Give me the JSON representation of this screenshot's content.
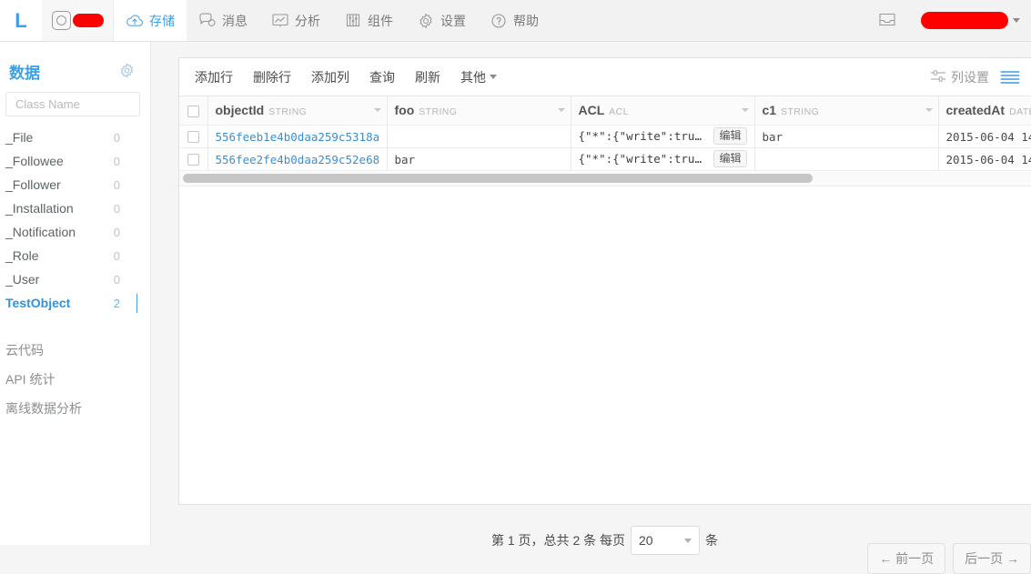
{
  "topnav": {
    "logo": "L",
    "app_name_redacted": "",
    "items": [
      {
        "label": "存储",
        "icon": "cloud-upload-icon",
        "active": true
      },
      {
        "label": "消息",
        "icon": "chat-icon",
        "active": false
      },
      {
        "label": "分析",
        "icon": "chart-icon",
        "active": false
      },
      {
        "label": "组件",
        "icon": "sliders-icon",
        "active": false
      },
      {
        "label": "设置",
        "icon": "gear-icon",
        "active": false
      },
      {
        "label": "帮助",
        "icon": "question-icon",
        "active": false
      }
    ],
    "inbox_icon": "inbox-icon",
    "user_name_redacted": ""
  },
  "sidebar": {
    "title": "数据",
    "settings_icon": "gear-icon",
    "search_placeholder": "Class Name",
    "search_value": "",
    "classes": [
      {
        "name": "_File",
        "count": "0",
        "selected": false
      },
      {
        "name": "_Followee",
        "count": "0",
        "selected": false
      },
      {
        "name": "_Follower",
        "count": "0",
        "selected": false
      },
      {
        "name": "_Installation",
        "count": "0",
        "selected": false
      },
      {
        "name": "_Notification",
        "count": "0",
        "selected": false
      },
      {
        "name": "_Role",
        "count": "0",
        "selected": false
      },
      {
        "name": "_User",
        "count": "0",
        "selected": false
      },
      {
        "name": "TestObject",
        "count": "2",
        "selected": true
      }
    ],
    "links": [
      {
        "label": "云代码"
      },
      {
        "label": "API 统计"
      },
      {
        "label": "离线数据分析"
      }
    ]
  },
  "toolbar": {
    "buttons": [
      {
        "label": "添加行"
      },
      {
        "label": "删除行"
      },
      {
        "label": "添加列"
      },
      {
        "label": "查询"
      },
      {
        "label": "刷新"
      },
      {
        "label": "其他",
        "caret": true
      }
    ],
    "column_settings_label": "列设置",
    "column_settings_icon": "sliders-icon",
    "rows_view_icon": "rows-icon"
  },
  "table": {
    "columns": [
      {
        "name": "objectId",
        "type": "STRING"
      },
      {
        "name": "foo",
        "type": "STRING"
      },
      {
        "name": "ACL",
        "type": "ACL"
      },
      {
        "name": "c1",
        "type": "STRING"
      },
      {
        "name": "createdAt",
        "type": "DATE"
      }
    ],
    "edit_label": "编辑",
    "rows": [
      {
        "objectId": "556feeb1e4b0daa259c5318a",
        "foo": "",
        "acl": "{\"*\":{\"write\":true,\"…",
        "c1": "bar",
        "createdAt": "2015-06-04 14"
      },
      {
        "objectId": "556fee2fe4b0daa259c52e68",
        "foo": "bar",
        "acl": "{\"*\":{\"write\":true,\"…",
        "c1": "",
        "createdAt": "2015-06-04 14"
      }
    ]
  },
  "pager": {
    "page_text": "第 1 页，总共 2 条 每页",
    "per_page_value": "20",
    "unit_text": "条",
    "prev_label": "← 前一页",
    "next_label": "后一页 →"
  },
  "colors": {
    "accent": "#3ca0e8",
    "redact": "#fe0000",
    "link": "#3a8fd4"
  }
}
